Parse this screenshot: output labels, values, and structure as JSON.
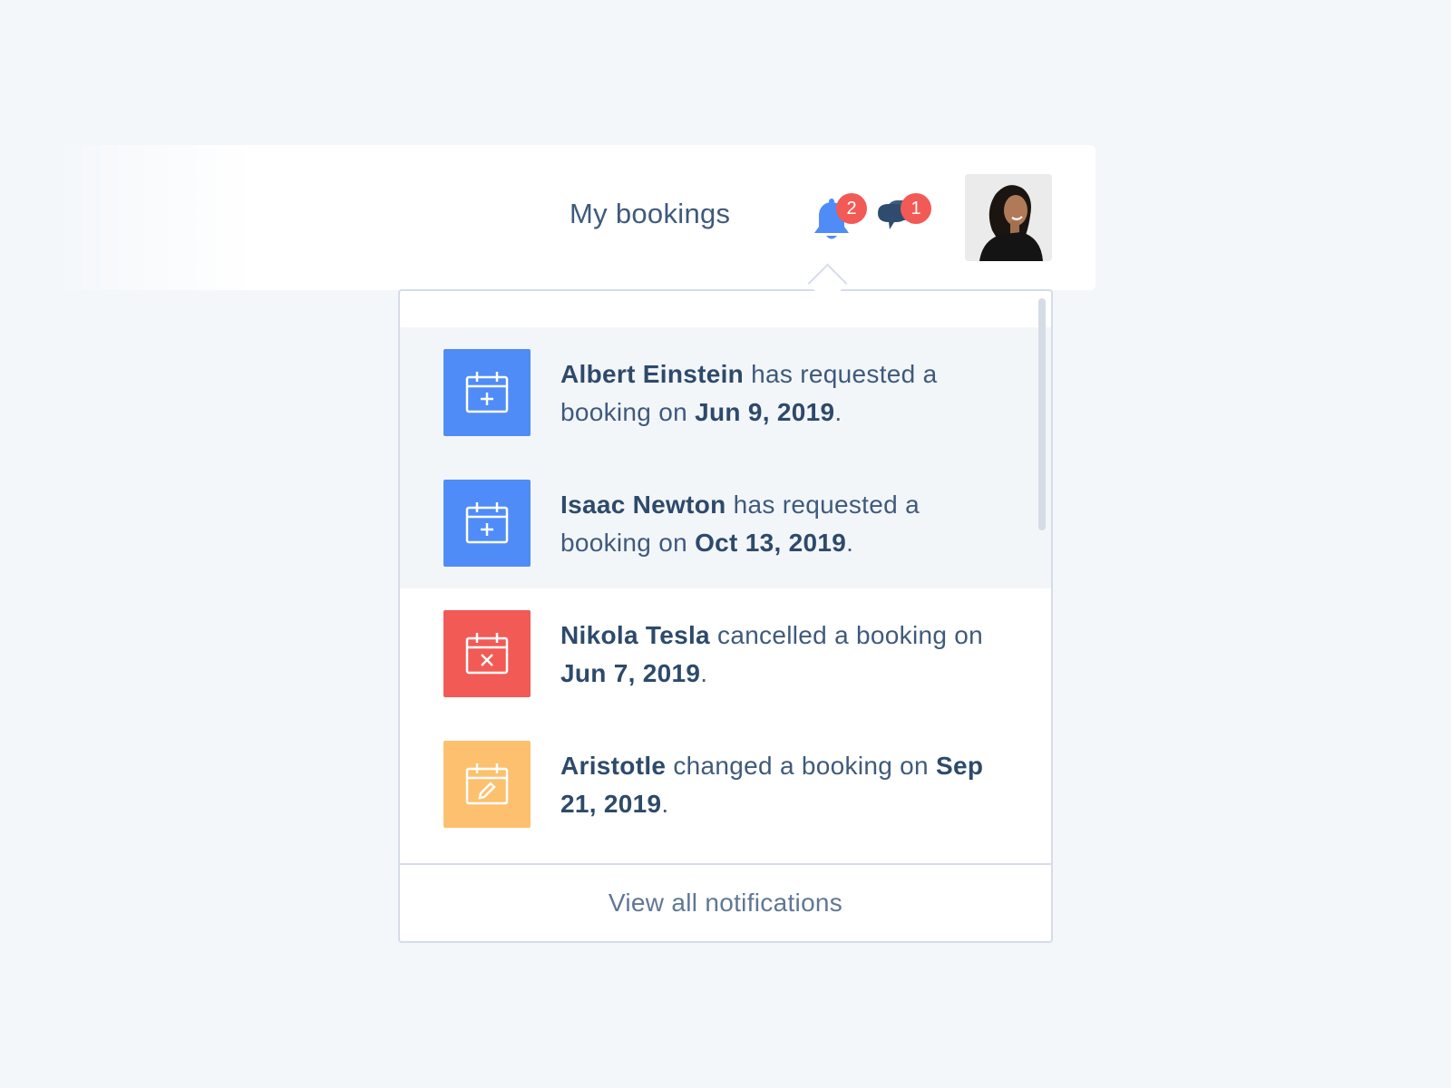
{
  "header": {
    "nav_link": "My bookings",
    "notifications_count": "2",
    "messages_count": "1",
    "avatar_alt": "User avatar"
  },
  "colors": {
    "accent_blue": "#4f8cf7",
    "danger_red": "#f25a55",
    "warning_orange": "#fdc06e",
    "text_navy": "#2d4a6b"
  },
  "notifications": [
    {
      "name": "Albert Einstein",
      "action": " has requested a booking on ",
      "date": "Jun 9, 2019",
      "end": ".",
      "icon": "calendar-plus-icon",
      "unread": true
    },
    {
      "name": "Isaac Newton",
      "action": " has requested a booking on ",
      "date": "Oct 13, 2019",
      "end": ".",
      "icon": "calendar-plus-icon",
      "unread": true
    },
    {
      "name": "Nikola Tesla",
      "action": " cancelled a booking on ",
      "date": "Jun 7, 2019",
      "end": ".",
      "icon": "calendar-x-icon",
      "unread": false
    },
    {
      "name": "Aristotle",
      "action": " changed a booking on ",
      "date": "Sep 21, 2019",
      "end": ".",
      "icon": "calendar-edit-icon",
      "unread": false
    }
  ],
  "footer": {
    "view_all": "View all notifications"
  }
}
